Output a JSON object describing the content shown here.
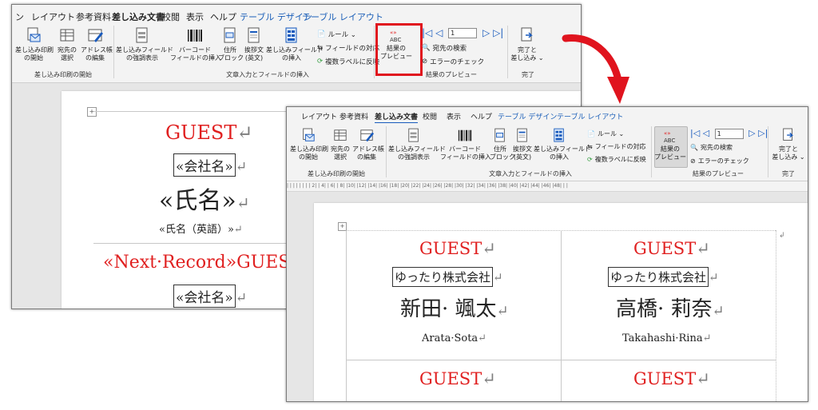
{
  "colors": {
    "accent": "#185abd",
    "guest_red": "#e02020",
    "highlight_red": "#e0141e"
  },
  "ribbon": {
    "tabs": [
      {
        "label": "ン"
      },
      {
        "label": "レイアウト"
      },
      {
        "label": "参考資料"
      },
      {
        "label": "差し込み文書"
      },
      {
        "label": "校閲"
      },
      {
        "label": "表示"
      },
      {
        "label": "ヘルプ"
      },
      {
        "label": "テーブル デザイン"
      },
      {
        "label": "テーブル レイアウト"
      }
    ],
    "start_mail_merge": "差し込み印刷\nの開始",
    "select_recipients": "宛先の\n選択",
    "edit_list": "アドレス帳\nの編集",
    "highlight_fields": "差し込みフィールド\nの強調表示",
    "barcode": "バーコード\nフィールドの挿入",
    "address_block": "住所\nブロック",
    "greeting": "挨拶文\n(英文)",
    "insert_field": "差し込みフィールド\nの挿入",
    "rules": "ルール",
    "match_fields": "フィールドの対応",
    "update_labels": "複数ラベルに反映",
    "preview_icon_label": "ABC",
    "preview_results": "結果の\nプレビュー",
    "record_number": "1",
    "find_recipient": "宛先の検索",
    "check_errors": "エラーのチェック",
    "finish": "完了と\n差し込み",
    "groups": {
      "start": "差し込み印刷の開始",
      "write_insert": "文章入力とフィールドの挿入",
      "preview": "結果のプレビュー",
      "finish": "完了"
    }
  },
  "nav_glyphs": {
    "first": "|◁",
    "prev": "◁",
    "next": "▷",
    "last": "▷|"
  },
  "before_doc": {
    "guest": "GUEST",
    "company_field": "«会社名»",
    "name_field": "«氏名»",
    "name_en_field": "«氏名（英語）»",
    "next_record": "«Next·Record»GUES",
    "company_field2": "«会社名»"
  },
  "after_doc": {
    "labels": [
      {
        "guest": "GUEST",
        "company": "ゆったり株式会社",
        "name": "新田· 颯太",
        "name_en": "Arata·Sota"
      },
      {
        "guest": "GUEST",
        "company": "ゆったり株式会社",
        "name": "高橋· 莉奈",
        "name_en": "Takahashi·Rina"
      }
    ],
    "guest2": "GUEST"
  },
  "marks": {
    "return": "↵",
    "para_end": "↲"
  },
  "ruler_text": "|  |  |  |  |  |  |  |  2|  |  4|  |  6|  |  8|  |10|  |12|  |14|  |16|  |18|  |20|  |22|  |24|  |26|  |28|  |30|  |32|  |34|  |36|  |38|  |40|  |42|  |44|  |46|  |48|  |  |"
}
